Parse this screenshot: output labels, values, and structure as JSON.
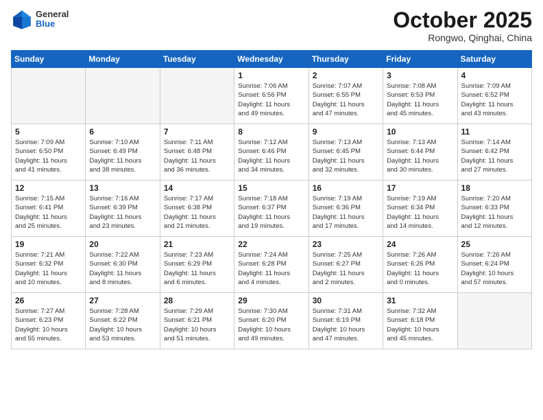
{
  "header": {
    "logo_general": "General",
    "logo_blue": "Blue",
    "month_title": "October 2025",
    "subtitle": "Rongwo, Qinghai, China"
  },
  "days_of_week": [
    "Sunday",
    "Monday",
    "Tuesday",
    "Wednesday",
    "Thursday",
    "Friday",
    "Saturday"
  ],
  "weeks": [
    [
      {
        "day": "",
        "info": ""
      },
      {
        "day": "",
        "info": ""
      },
      {
        "day": "",
        "info": ""
      },
      {
        "day": "1",
        "info": "Sunrise: 7:06 AM\nSunset: 6:56 PM\nDaylight: 11 hours\nand 49 minutes."
      },
      {
        "day": "2",
        "info": "Sunrise: 7:07 AM\nSunset: 6:55 PM\nDaylight: 11 hours\nand 47 minutes."
      },
      {
        "day": "3",
        "info": "Sunrise: 7:08 AM\nSunset: 6:53 PM\nDaylight: 11 hours\nand 45 minutes."
      },
      {
        "day": "4",
        "info": "Sunrise: 7:09 AM\nSunset: 6:52 PM\nDaylight: 11 hours\nand 43 minutes."
      }
    ],
    [
      {
        "day": "5",
        "info": "Sunrise: 7:09 AM\nSunset: 6:50 PM\nDaylight: 11 hours\nand 41 minutes."
      },
      {
        "day": "6",
        "info": "Sunrise: 7:10 AM\nSunset: 6:49 PM\nDaylight: 11 hours\nand 38 minutes."
      },
      {
        "day": "7",
        "info": "Sunrise: 7:11 AM\nSunset: 6:48 PM\nDaylight: 11 hours\nand 36 minutes."
      },
      {
        "day": "8",
        "info": "Sunrise: 7:12 AM\nSunset: 6:46 PM\nDaylight: 11 hours\nand 34 minutes."
      },
      {
        "day": "9",
        "info": "Sunrise: 7:13 AM\nSunset: 6:45 PM\nDaylight: 11 hours\nand 32 minutes."
      },
      {
        "day": "10",
        "info": "Sunrise: 7:13 AM\nSunset: 6:44 PM\nDaylight: 11 hours\nand 30 minutes."
      },
      {
        "day": "11",
        "info": "Sunrise: 7:14 AM\nSunset: 6:42 PM\nDaylight: 11 hours\nand 27 minutes."
      }
    ],
    [
      {
        "day": "12",
        "info": "Sunrise: 7:15 AM\nSunset: 6:41 PM\nDaylight: 11 hours\nand 25 minutes."
      },
      {
        "day": "13",
        "info": "Sunrise: 7:16 AM\nSunset: 6:39 PM\nDaylight: 11 hours\nand 23 minutes."
      },
      {
        "day": "14",
        "info": "Sunrise: 7:17 AM\nSunset: 6:38 PM\nDaylight: 11 hours\nand 21 minutes."
      },
      {
        "day": "15",
        "info": "Sunrise: 7:18 AM\nSunset: 6:37 PM\nDaylight: 11 hours\nand 19 minutes."
      },
      {
        "day": "16",
        "info": "Sunrise: 7:19 AM\nSunset: 6:36 PM\nDaylight: 11 hours\nand 17 minutes."
      },
      {
        "day": "17",
        "info": "Sunrise: 7:19 AM\nSunset: 6:34 PM\nDaylight: 11 hours\nand 14 minutes."
      },
      {
        "day": "18",
        "info": "Sunrise: 7:20 AM\nSunset: 6:33 PM\nDaylight: 11 hours\nand 12 minutes."
      }
    ],
    [
      {
        "day": "19",
        "info": "Sunrise: 7:21 AM\nSunset: 6:32 PM\nDaylight: 11 hours\nand 10 minutes."
      },
      {
        "day": "20",
        "info": "Sunrise: 7:22 AM\nSunset: 6:30 PM\nDaylight: 11 hours\nand 8 minutes."
      },
      {
        "day": "21",
        "info": "Sunrise: 7:23 AM\nSunset: 6:29 PM\nDaylight: 11 hours\nand 6 minutes."
      },
      {
        "day": "22",
        "info": "Sunrise: 7:24 AM\nSunset: 6:28 PM\nDaylight: 11 hours\nand 4 minutes."
      },
      {
        "day": "23",
        "info": "Sunrise: 7:25 AM\nSunset: 6:27 PM\nDaylight: 11 hours\nand 2 minutes."
      },
      {
        "day": "24",
        "info": "Sunrise: 7:26 AM\nSunset: 6:26 PM\nDaylight: 11 hours\nand 0 minutes."
      },
      {
        "day": "25",
        "info": "Sunrise: 7:26 AM\nSunset: 6:24 PM\nDaylight: 10 hours\nand 57 minutes."
      }
    ],
    [
      {
        "day": "26",
        "info": "Sunrise: 7:27 AM\nSunset: 6:23 PM\nDaylight: 10 hours\nand 55 minutes."
      },
      {
        "day": "27",
        "info": "Sunrise: 7:28 AM\nSunset: 6:22 PM\nDaylight: 10 hours\nand 53 minutes."
      },
      {
        "day": "28",
        "info": "Sunrise: 7:29 AM\nSunset: 6:21 PM\nDaylight: 10 hours\nand 51 minutes."
      },
      {
        "day": "29",
        "info": "Sunrise: 7:30 AM\nSunset: 6:20 PM\nDaylight: 10 hours\nand 49 minutes."
      },
      {
        "day": "30",
        "info": "Sunrise: 7:31 AM\nSunset: 6:19 PM\nDaylight: 10 hours\nand 47 minutes."
      },
      {
        "day": "31",
        "info": "Sunrise: 7:32 AM\nSunset: 6:18 PM\nDaylight: 10 hours\nand 45 minutes."
      },
      {
        "day": "",
        "info": ""
      }
    ]
  ]
}
